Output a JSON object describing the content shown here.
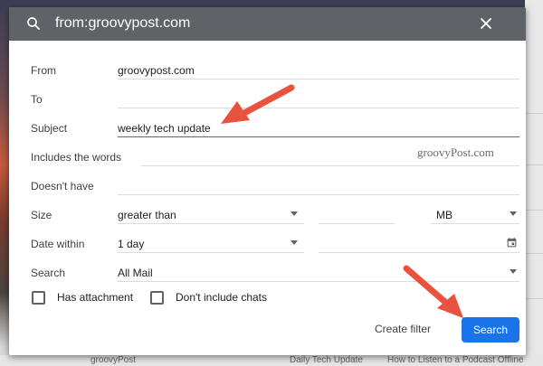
{
  "search": {
    "query": "from:groovypost.com"
  },
  "fields": {
    "from": {
      "label": "From",
      "value": "groovypost.com"
    },
    "to": {
      "label": "To",
      "value": ""
    },
    "subject": {
      "label": "Subject",
      "value": "weekly tech update"
    },
    "includes": {
      "label": "Includes the words",
      "value": ""
    },
    "doesnt_have": {
      "label": "Doesn't have",
      "value": ""
    },
    "size": {
      "label": "Size",
      "comparator": "greater than",
      "unit": "MB"
    },
    "date_within": {
      "label": "Date within",
      "value": "1 day"
    },
    "search_in": {
      "label": "Search",
      "value": "All Mail"
    }
  },
  "checkboxes": {
    "has_attachment": "Has attachment",
    "dont_include_chats": "Don't include chats"
  },
  "actions": {
    "create_filter": "Create filter",
    "search": "Search"
  },
  "watermark": "groovyPost.com",
  "background_strip": {
    "sender": "groovyPost",
    "subject": "Daily Tech Update",
    "snippet": "How to Listen to a Podcast Offline"
  },
  "colors": {
    "primary_button": "#1a73e8",
    "search_bar": "#5f6368",
    "annotation_arrow": "#e8523f"
  },
  "icons": {
    "search": "search-icon",
    "close": "close-icon",
    "calendar": "calendar-icon",
    "dropdown": "chevron-down-icon"
  }
}
